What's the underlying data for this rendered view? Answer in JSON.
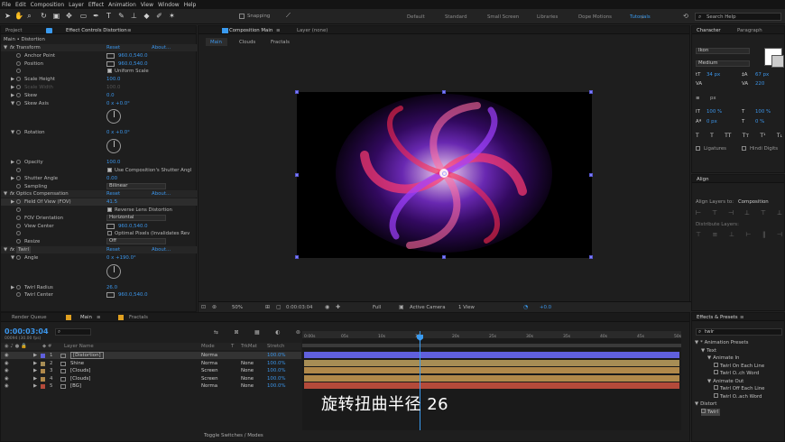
{
  "menu": [
    "File",
    "Edit",
    "Composition",
    "Layer",
    "Effect",
    "Animation",
    "View",
    "Window",
    "Help"
  ],
  "toolbar": {
    "snapping": "Snapping",
    "workspaces": [
      "Default",
      "Standard",
      "Small Screen",
      "Libraries",
      "Dope Motions",
      "Tutorials"
    ],
    "active_workspace": "Tutorials",
    "search": "Search Help"
  },
  "left_panel": {
    "tabs": [
      "Project",
      "Effect Controls Distortion"
    ],
    "header": "Main • Distortion"
  },
  "effects": [
    {
      "label": "Transform",
      "indent": 0,
      "fx": true,
      "twirl": "down",
      "reset": "Reset",
      "about": "About..."
    },
    {
      "label": "Anchor Point",
      "indent": 2,
      "value": "960.0,540.0",
      "crosshair": true
    },
    {
      "label": "Position",
      "indent": 2,
      "value": "960.0,540.0",
      "crosshair": true
    },
    {
      "label": "",
      "indent": 2,
      "check": "Uniform Scale"
    },
    {
      "label": "Scale Height",
      "indent": 1,
      "twirl": "right",
      "value": "100.0"
    },
    {
      "label": "Scale Width",
      "indent": 1,
      "twirl": "right",
      "value": "100.0",
      "dim": true
    },
    {
      "label": "Skew",
      "indent": 1,
      "twirl": "right",
      "value": "0.0"
    },
    {
      "label": "Skew Axis",
      "indent": 1,
      "twirl": "down",
      "value": "0 x +0.0°"
    },
    {
      "dial": true,
      "h": 24
    },
    {
      "label": "Rotation",
      "indent": 1,
      "twirl": "down",
      "value": "0 x +0.0°"
    },
    {
      "dial": true,
      "h": 24
    },
    {
      "label": "Opacity",
      "indent": 1,
      "twirl": "right",
      "value": "100.0"
    },
    {
      "label": "",
      "indent": 2,
      "check": "Use Composition's Shutter Angl"
    },
    {
      "label": "Shutter Angle",
      "indent": 1,
      "twirl": "right",
      "value": "0.00"
    },
    {
      "label": "Sampling",
      "indent": 2,
      "dropdown": "Bilinear"
    },
    {
      "label": "Optics Compensation",
      "indent": 0,
      "fx": true,
      "twirl": "down",
      "reset": "Reset",
      "about": "About..."
    },
    {
      "label": "Field Of View (FOV)",
      "indent": 1,
      "twirl": "right",
      "value": "41.5",
      "highlight": true
    },
    {
      "label": "",
      "indent": 2,
      "check": "Reverse Lens Distortion"
    },
    {
      "label": "FOV Orientation",
      "indent": 2,
      "dropdown": "Horizontal"
    },
    {
      "label": "View Center",
      "indent": 2,
      "value": "960.0,540.0",
      "crosshair": true
    },
    {
      "label": "",
      "indent": 2,
      "check": "Optimal Pixels (Invalidates Rev",
      "unchecked": true
    },
    {
      "label": "Resize",
      "indent": 2,
      "dropdown": "Off"
    },
    {
      "label": "Twirl",
      "indent": 0,
      "fx": true,
      "twirl": "down",
      "reset": "Reset",
      "about": "About...",
      "boxed": true
    },
    {
      "label": "Angle",
      "indent": 1,
      "twirl": "down",
      "value": "0 x +190.0°"
    },
    {
      "dial": true,
      "h": 24
    },
    {
      "label": "Twirl Radius",
      "indent": 1,
      "twirl": "right",
      "value": "26.0"
    },
    {
      "label": "Twirl Center",
      "indent": 2,
      "value": "960.0,540.0",
      "crosshair": true
    }
  ],
  "comp": {
    "tabs": [
      "Composition Main",
      "Layer (none)"
    ],
    "active_tab": "Composition Main",
    "breadcrumbs": [
      "Main",
      "Clouds",
      "Fractals"
    ],
    "footer": {
      "zoom": "50%",
      "timecode": "0:00:03:04",
      "resolution": "Full",
      "camera": "Active Camera",
      "view": "1 View",
      "exposure": "+0.0"
    }
  },
  "right": {
    "char_tabs": [
      "Character",
      "Paragraph"
    ],
    "font": "Ikon",
    "style": "Medium",
    "font_size": "34 px",
    "leading": "67 px",
    "tracking": "220",
    "unit": "px",
    "scale_v": "100 %",
    "scale_h": "100 %",
    "baseline": "0 px",
    "tsume": "0 %",
    "ligatures": "Ligatures",
    "hindi": "Hindi Digits",
    "align": {
      "title": "Align",
      "align_to_label": "Align Layers to:",
      "align_to": "Composition",
      "distribute": "Distribute Layers:"
    },
    "effects": {
      "title": "Effects & Presets",
      "search": "twir",
      "tree": [
        {
          "t": "* Animation Presets",
          "lv": 0,
          "dd": true
        },
        {
          "t": "Text",
          "lv": 1,
          "dd": true
        },
        {
          "t": "Animate In",
          "lv": 2,
          "dd": true
        },
        {
          "t": "Twirl On Each Line",
          "lv": 3,
          "icon": true
        },
        {
          "t": "Twirl O..ch Word",
          "lv": 3,
          "icon": true
        },
        {
          "t": "Animate Out",
          "lv": 2,
          "dd": true
        },
        {
          "t": "Twirl Off Each Line",
          "lv": 3,
          "icon": true
        },
        {
          "t": "Twirl O..ach Word",
          "lv": 3,
          "icon": true
        },
        {
          "t": "Distort",
          "lv": 0,
          "dd": true
        },
        {
          "t": "Twirl",
          "lv": 1,
          "icon": true,
          "sel": true
        }
      ]
    }
  },
  "timeline": {
    "tabs": [
      "Render Queue",
      "Main",
      "Fractals"
    ],
    "active_tab": "Main",
    "timecode": "0:00:03:04",
    "frame": "00094 (30.00 fps)",
    "columns": [
      "Layer Name",
      "Mode",
      "T",
      "TrkMat",
      "Stretch"
    ],
    "ruler": [
      "0:00s",
      "05s",
      "10s",
      "15s",
      "20s",
      "25s",
      "30s",
      "35s",
      "40s",
      "45s",
      "50s"
    ],
    "layers": [
      {
        "num": "1",
        "name": "[Distortion]",
        "mode": "Norma",
        "trk": "",
        "stretch": "100.0%",
        "color": "#6060dd",
        "sel": true
      },
      {
        "num": "2",
        "name": "Shine",
        "mode": "Norma",
        "trk": "None",
        "stretch": "100.0%",
        "color": "#a78d55"
      },
      {
        "num": "3",
        "name": "[Clouds]",
        "mode": "Screen",
        "trk": "None",
        "stretch": "100.0%",
        "color": "#b0884a"
      },
      {
        "num": "4",
        "name": "[Clouds]",
        "mode": "Screen",
        "trk": "None",
        "stretch": "100.0%",
        "color": "#b0884a"
      },
      {
        "num": "5",
        "name": "[BG]",
        "mode": "Norma",
        "trk": "None",
        "stretch": "100.0%",
        "color": "#b44a3a"
      }
    ],
    "toggle": "Toggle Switches / Modes"
  },
  "subtitle": "旋转扭曲半径 26"
}
